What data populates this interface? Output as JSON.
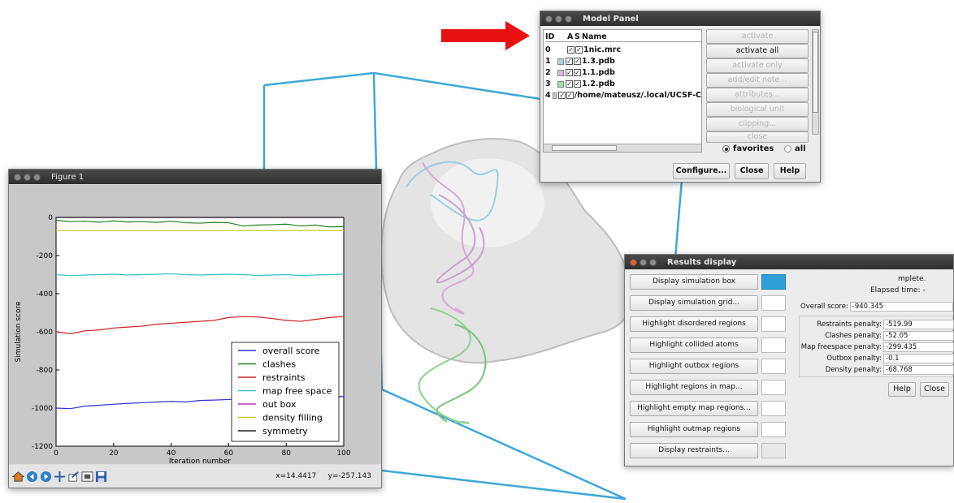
{
  "model_panel": {
    "title": "Model Panel",
    "headers": {
      "id": "ID",
      "a": "A",
      "s": "S",
      "name": "Name"
    },
    "rows": [
      {
        "id": "0",
        "name": "1nic.mrc",
        "color": "#ffffff"
      },
      {
        "id": "1",
        "name": "1.3.pdb",
        "color": "#a8d4e8"
      },
      {
        "id": "2",
        "name": "1.1.pdb",
        "color": "#e2b6e2"
      },
      {
        "id": "3",
        "name": "1.2.pdb",
        "color": "#9fe0a0"
      },
      {
        "id": "4",
        "name": "/home/mateusz/.local/UCSF-C",
        "color": "#d0d0d0"
      }
    ],
    "actions": [
      "activate",
      "activate all",
      "activate only",
      "add/edit note...",
      "attributes...",
      "biological unit",
      "clipping...",
      "close"
    ],
    "radio_favorites": "favorites",
    "radio_all": "all",
    "configure_label": "Configure...",
    "close_label": "Close",
    "help_label": "Help"
  },
  "figure": {
    "title": "Figure 1",
    "coords": "x=14.4417     y=-257.143",
    "toolbar_icons": [
      "home-icon",
      "back-icon",
      "forward-icon",
      "pan-icon",
      "zoom-icon",
      "subplots-icon",
      "save-icon"
    ]
  },
  "results": {
    "title": "Results display",
    "buttons": [
      {
        "label": "Display simulation box",
        "swatch": "#2e9fd8"
      },
      {
        "label": "Display simulation grid...",
        "swatch": "#ffffff"
      },
      {
        "label": "Highlight disordered regions",
        "swatch": "#ffffff"
      },
      {
        "label": "Highlight collided atoms",
        "swatch": "#ffffff"
      },
      {
        "label": "Highlight outbox regions",
        "swatch": "#ffffff"
      },
      {
        "label": "Highlight regions in map...",
        "swatch": "#ffffff"
      },
      {
        "label": "Highlight empty map regions...",
        "swatch": "#ffffff"
      },
      {
        "label": "Highlight outmap regions",
        "swatch": "#ffffff"
      },
      {
        "label": "Display restraints...",
        "swatch": "#e8e8e8"
      }
    ],
    "status_line1": "mplete.",
    "status_line2": "Elapsed time: -",
    "overall_label": "Overall score:",
    "overall_value": "-940.345",
    "penalties": [
      {
        "label": "Restraints penalty:",
        "value": "-519.99"
      },
      {
        "label": "Clashes penalty:",
        "value": "-52.05"
      },
      {
        "label": "Map freespace penalty:",
        "value": "-299.435"
      },
      {
        "label": "Outbox penalty:",
        "value": "-0.1"
      },
      {
        "label": "Density penalty:",
        "value": "-68.768"
      }
    ],
    "help_label": "Help",
    "close_label": "Close"
  },
  "chart_data": {
    "type": "line",
    "xlabel": "Iteration number",
    "ylabel": "Simulation score",
    "xlim": [
      0,
      100
    ],
    "ylim": [
      -1200,
      0
    ],
    "xticks": [
      0,
      20,
      40,
      60,
      80,
      100
    ],
    "yticks": [
      0,
      -200,
      -400,
      -600,
      -800,
      -1000,
      -1200
    ],
    "legend_position": "lower-right",
    "series": [
      {
        "name": "overall score",
        "color": "#3030d0",
        "x": [
          0,
          5,
          10,
          15,
          20,
          25,
          30,
          35,
          40,
          45,
          50,
          55,
          60,
          65,
          70,
          75,
          80,
          85,
          90,
          95,
          100
        ],
        "y": [
          -1000,
          -1003,
          -990,
          -985,
          -980,
          -975,
          -972,
          -968,
          -965,
          -968,
          -960,
          -958,
          -955,
          -950,
          -948,
          -945,
          -944,
          -942,
          -942,
          -940,
          -940
        ]
      },
      {
        "name": "clashes",
        "color": "#208020",
        "x": [
          0,
          5,
          10,
          15,
          20,
          25,
          30,
          35,
          40,
          45,
          50,
          55,
          60,
          65,
          70,
          75,
          80,
          85,
          90,
          95,
          100
        ],
        "y": [
          -15,
          -22,
          -20,
          -25,
          -18,
          -24,
          -22,
          -26,
          -20,
          -28,
          -30,
          -26,
          -28,
          -45,
          -40,
          -38,
          -35,
          -45,
          -40,
          -50,
          -48
        ]
      },
      {
        "name": "restraints",
        "color": "#d02020",
        "x": [
          0,
          5,
          10,
          15,
          20,
          25,
          30,
          35,
          40,
          45,
          50,
          55,
          60,
          65,
          70,
          75,
          80,
          85,
          90,
          95,
          100
        ],
        "y": [
          -600,
          -610,
          -595,
          -590,
          -580,
          -575,
          -570,
          -560,
          -555,
          -550,
          -545,
          -540,
          -525,
          -520,
          -522,
          -530,
          -540,
          -545,
          -535,
          -525,
          -520
        ]
      },
      {
        "name": "map free space",
        "color": "#30c0c8",
        "x": [
          0,
          5,
          10,
          15,
          20,
          25,
          30,
          35,
          40,
          45,
          50,
          55,
          60,
          65,
          70,
          75,
          80,
          85,
          90,
          95,
          100
        ],
        "y": [
          -300,
          -305,
          -302,
          -300,
          -298,
          -302,
          -300,
          -298,
          -296,
          -300,
          -302,
          -300,
          -298,
          -300,
          -304,
          -302,
          -300,
          -305,
          -302,
          -300,
          -298
        ]
      },
      {
        "name": "out box",
        "color": "#c030c0",
        "x": [
          0,
          100
        ],
        "y": [
          0,
          0
        ]
      },
      {
        "name": "density filling",
        "color": "#c8c820",
        "x": [
          0,
          100
        ],
        "y": [
          -69,
          -69
        ]
      },
      {
        "name": "symmetry",
        "color": "#222222",
        "x": [
          0,
          100
        ],
        "y": [
          0,
          0
        ]
      }
    ]
  }
}
